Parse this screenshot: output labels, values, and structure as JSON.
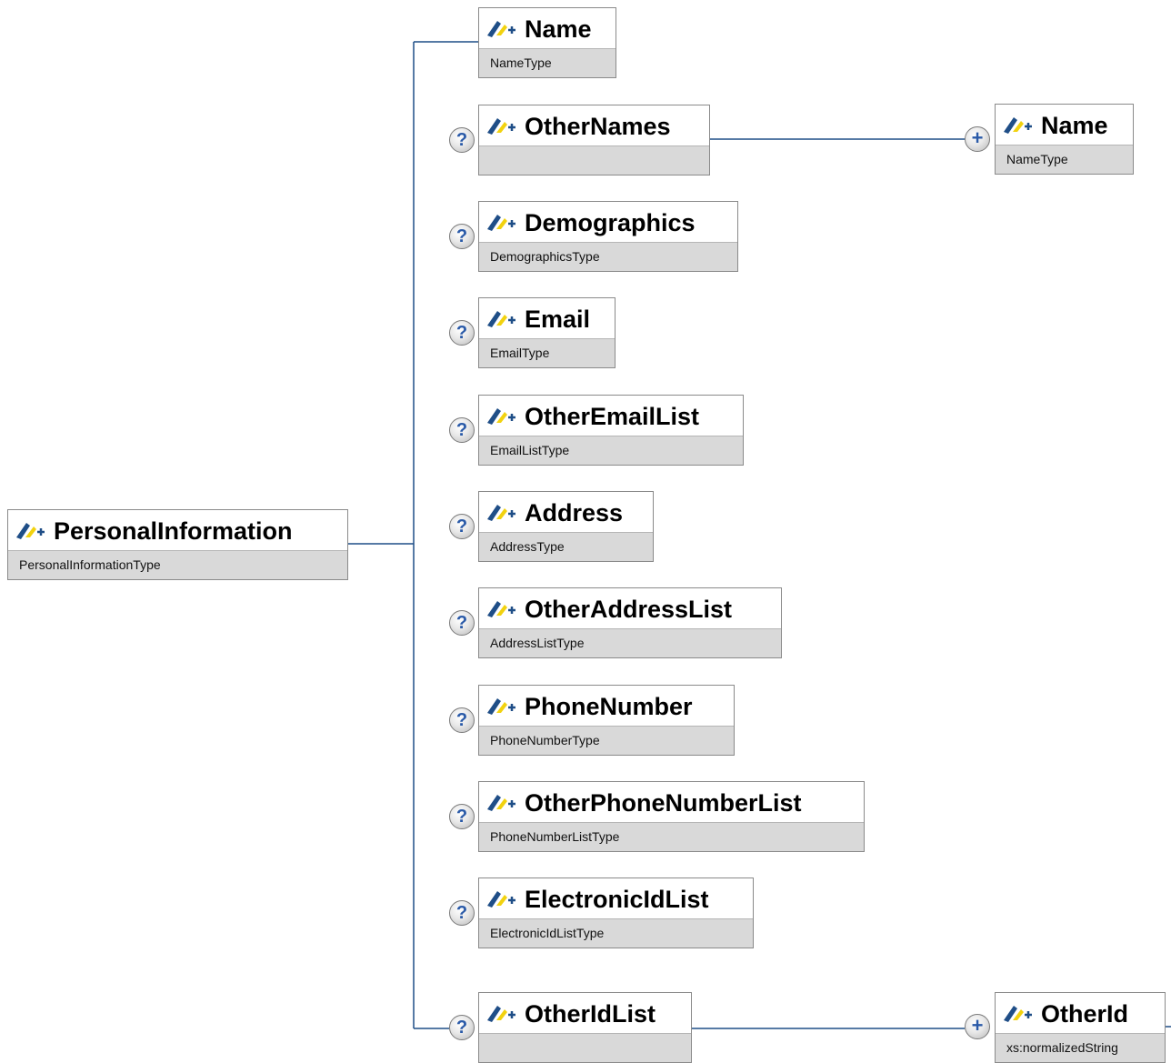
{
  "root": {
    "name": "PersonalInformation",
    "type": "PersonalInformationType"
  },
  "children": [
    {
      "name": "Name",
      "type": "NameType",
      "optional": false
    },
    {
      "name": "OtherNames",
      "type": "",
      "optional": true
    },
    {
      "name": "Demographics",
      "type": "DemographicsType",
      "optional": true
    },
    {
      "name": "Email",
      "type": "EmailType",
      "optional": true
    },
    {
      "name": "OtherEmailList",
      "type": "EmailListType",
      "optional": true
    },
    {
      "name": "Address",
      "type": "AddressType",
      "optional": true
    },
    {
      "name": "OtherAddressList",
      "type": "AddressListType",
      "optional": true
    },
    {
      "name": "PhoneNumber",
      "type": "PhoneNumberType",
      "optional": true
    },
    {
      "name": "OtherPhoneNumberList",
      "type": "PhoneNumberListType",
      "optional": true
    },
    {
      "name": "ElectronicIdList",
      "type": "ElectronicIdListType",
      "optional": true
    },
    {
      "name": "OtherIdList",
      "type": "",
      "optional": true
    }
  ],
  "grandchildren": [
    {
      "parent": "OtherNames",
      "name": "Name",
      "type": "NameType",
      "repeatable": true
    },
    {
      "parent": "OtherIdList",
      "name": "OtherId",
      "type": "xs:normalizedString",
      "repeatable": true
    }
  ],
  "badges": {
    "optional_symbol": "?",
    "repeat_symbol": "+"
  },
  "colors": {
    "connector": "#1f4e87",
    "type_band": "#d9d9d9",
    "icon_blue": "#1f4e87",
    "icon_yellow": "#f2d20f",
    "badge_text": "#2a5aa8"
  },
  "icons": {
    "element": "element-icon",
    "optional": "question-badge-icon",
    "repeat": "plus-badge-icon"
  }
}
